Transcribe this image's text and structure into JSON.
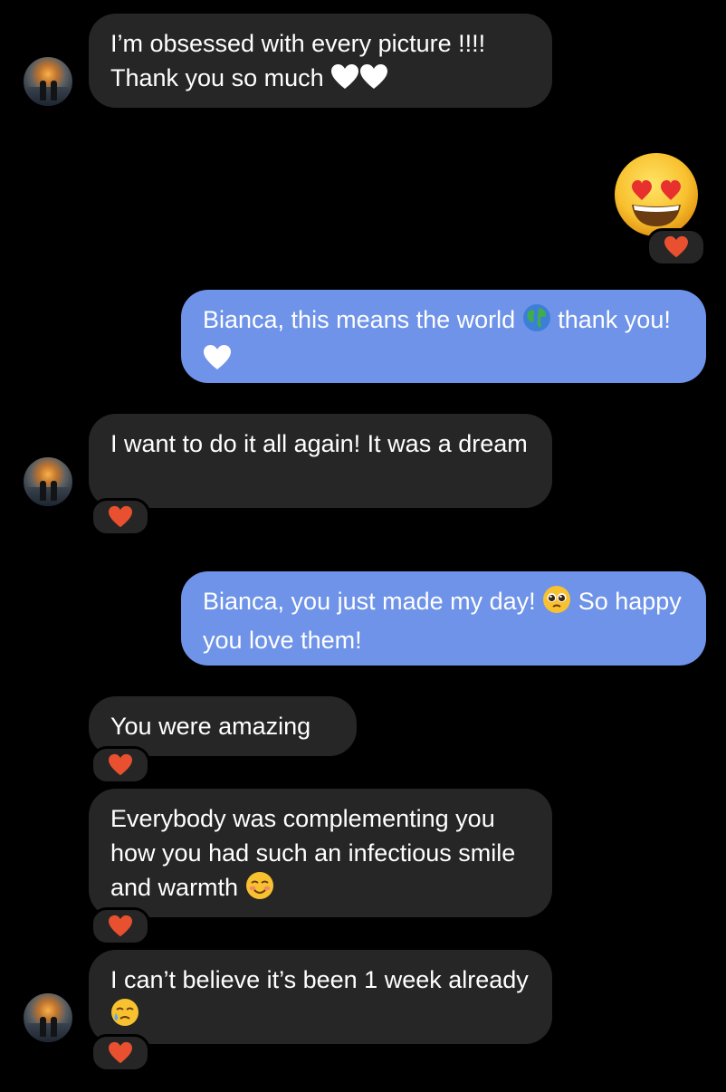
{
  "messages": [
    {
      "id": "m1",
      "sender": "other",
      "text": "I’m obsessed with every picture !!!! Thank you so much",
      "emoji": [
        "white-heart",
        "white-heart"
      ]
    },
    {
      "id": "m2",
      "sender": "me",
      "emoji_only": "heart-eyes",
      "reaction": "heart"
    },
    {
      "id": "m3",
      "sender": "me",
      "text_a": "Bianca, this means the world",
      "text_b": "thank",
      "text_c": "you!",
      "emoji": [
        "globe",
        "white-heart"
      ]
    },
    {
      "id": "m4",
      "sender": "other",
      "text": "I want to do it all again! It was a dream",
      "reaction": "heart"
    },
    {
      "id": "m5",
      "sender": "me",
      "text_a": "Bianca, you just made my day!",
      "text_b": "So happy you love them!",
      "emoji": [
        "pleading-face"
      ]
    },
    {
      "id": "m6",
      "sender": "other",
      "text": "You were amazing",
      "reaction": "heart"
    },
    {
      "id": "m7",
      "sender": "other",
      "text": "Everybody was complementing you how you had such an infectious smile and warmth",
      "emoji": [
        "smiling-blush"
      ],
      "reaction": "heart"
    },
    {
      "id": "m8",
      "sender": "other",
      "text_a": "I can’t believe it’s been 1 week",
      "text_b": "already",
      "emoji": [
        "holding-back-tears"
      ],
      "reaction": "heart"
    }
  ],
  "colors": {
    "background": "#000000",
    "incoming_bubble": "#262626",
    "outgoing_bubble": "#6e93e8",
    "reaction_heart": "#e8502f"
  }
}
